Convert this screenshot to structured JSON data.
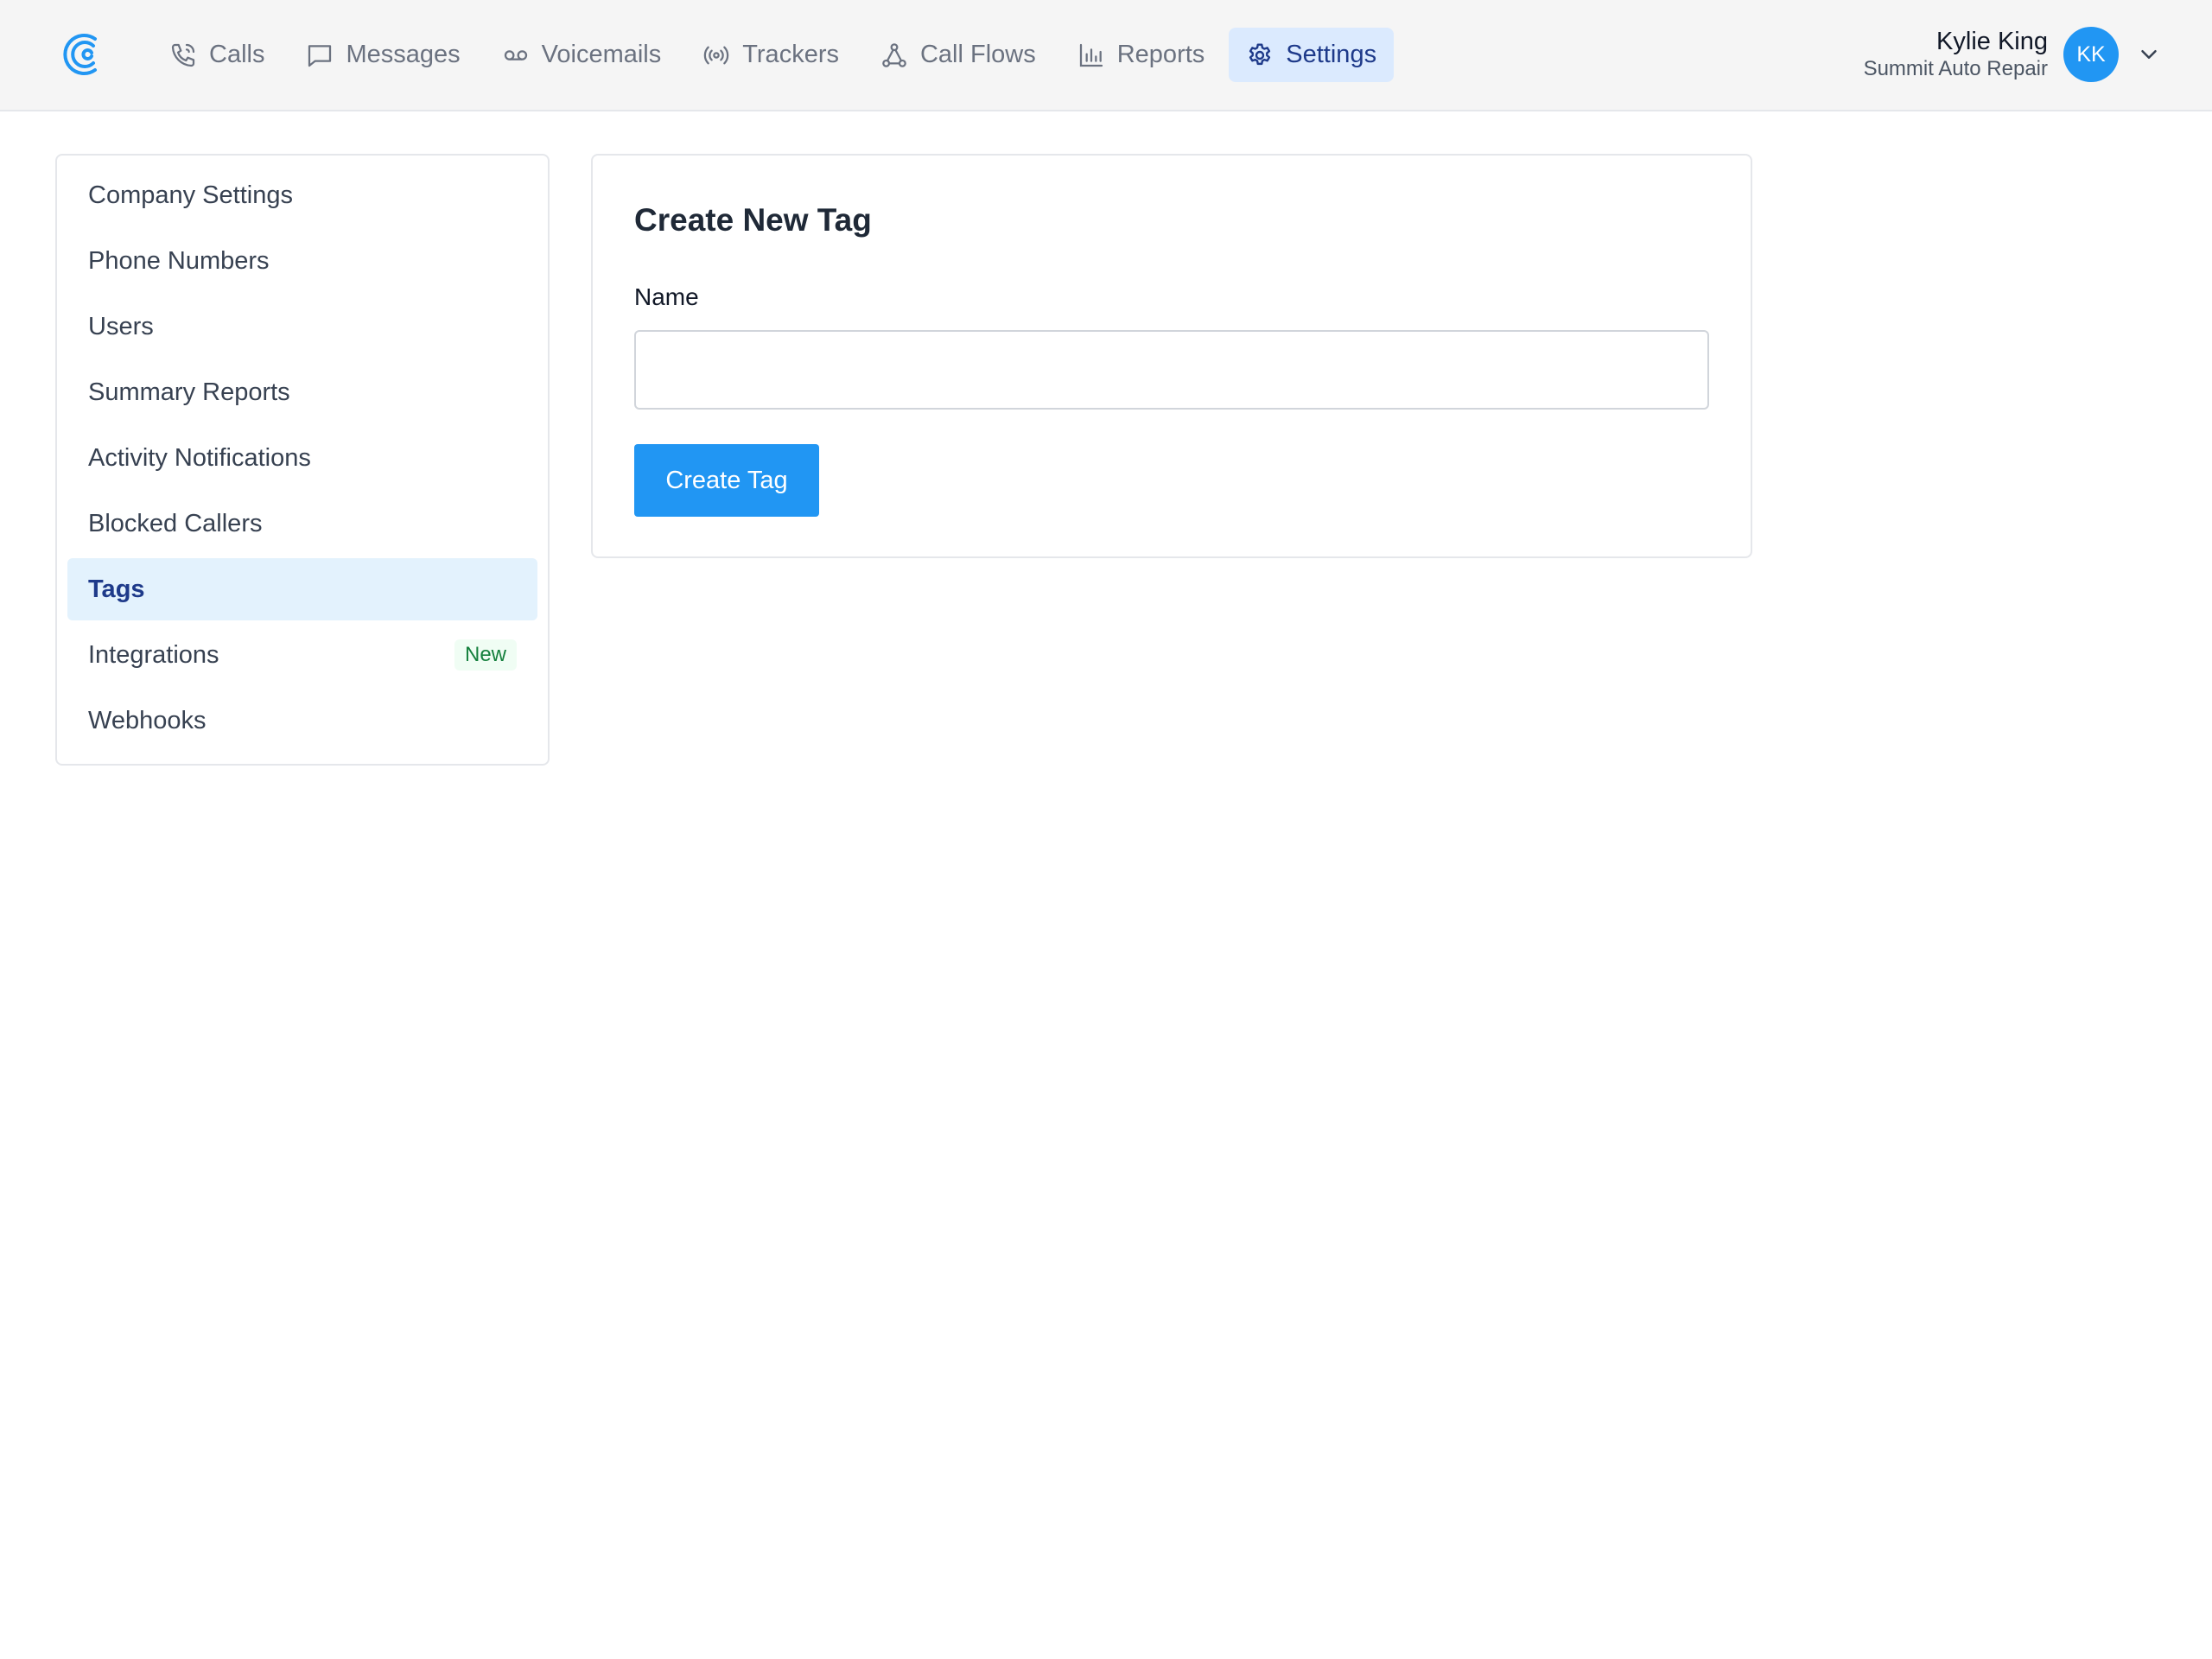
{
  "nav": {
    "items": [
      {
        "label": "Calls",
        "icon": "phone-icon"
      },
      {
        "label": "Messages",
        "icon": "message-icon"
      },
      {
        "label": "Voicemails",
        "icon": "voicemail-icon"
      },
      {
        "label": "Trackers",
        "icon": "broadcast-icon"
      },
      {
        "label": "Call Flows",
        "icon": "flow-icon"
      },
      {
        "label": "Reports",
        "icon": "bar-chart-icon"
      },
      {
        "label": "Settings",
        "icon": "gear-icon",
        "active": true
      }
    ]
  },
  "user": {
    "name": "Kylie King",
    "organization": "Summit Auto Repair",
    "initials": "KK"
  },
  "sidebar": {
    "items": [
      {
        "label": "Company Settings"
      },
      {
        "label": "Phone Numbers"
      },
      {
        "label": "Users"
      },
      {
        "label": "Summary Reports"
      },
      {
        "label": "Activity Notifications"
      },
      {
        "label": "Blocked Callers"
      },
      {
        "label": "Tags",
        "active": true
      },
      {
        "label": "Integrations",
        "badge": "New"
      },
      {
        "label": "Webhooks"
      }
    ]
  },
  "form": {
    "title": "Create New Tag",
    "name_label": "Name",
    "name_value": "",
    "submit_label": "Create Tag"
  },
  "colors": {
    "accent": "#2196f3",
    "active_nav_bg": "#dbeafe",
    "active_text": "#1e3a8a",
    "badge_text": "#15803d"
  }
}
